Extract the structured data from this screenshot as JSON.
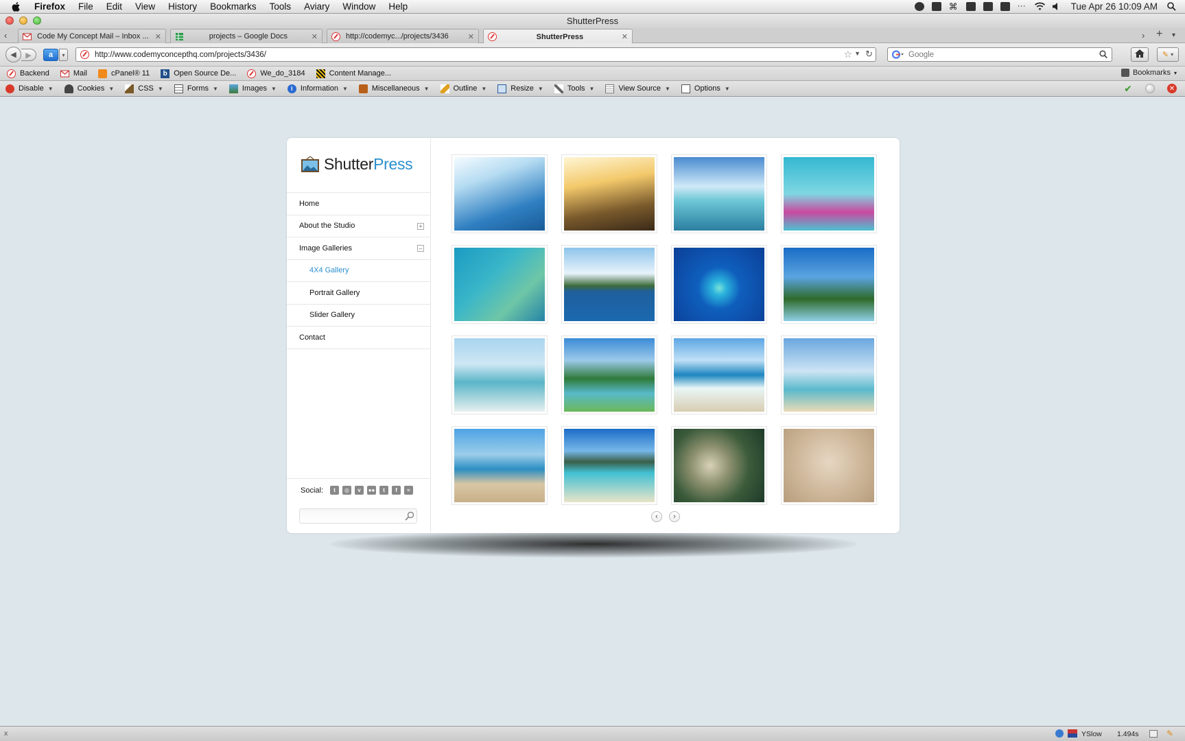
{
  "menubar": {
    "app_name": "Firefox",
    "items": [
      "File",
      "Edit",
      "View",
      "History",
      "Bookmarks",
      "Tools",
      "Aviary",
      "Window",
      "Help"
    ],
    "clock": "Tue Apr 26  10:09 AM"
  },
  "window": {
    "title": "ShutterPress"
  },
  "tabs": [
    {
      "label": "Code My Concept Mail – Inbox ..."
    },
    {
      "label": "projects – Google Docs"
    },
    {
      "label": "http://codemyc.../projects/3436"
    },
    {
      "label": "ShutterPress"
    }
  ],
  "navbar": {
    "url": "http://www.codemyconcepthq.com/projects/3436/",
    "search_placeholder": "Google"
  },
  "bookmarks": {
    "items": [
      "Backend",
      "Mail",
      "cPanel® 11",
      "Open Source De...",
      "We_do_3184",
      "Content Manage..."
    ],
    "right_label": "Bookmarks"
  },
  "devtoolbar": {
    "items": [
      "Disable",
      "Cookies",
      "CSS",
      "Forms",
      "Images",
      "Information",
      "Miscellaneous",
      "Outline",
      "Resize",
      "Tools",
      "View Source",
      "Options"
    ]
  },
  "site": {
    "logo": {
      "part1": "Shutter",
      "part2": "Press"
    },
    "nav": [
      {
        "label": "Home",
        "toggle": ""
      },
      {
        "label": "About the Studio",
        "toggle": "+"
      },
      {
        "label": "Image Galleries",
        "toggle": "–"
      },
      {
        "label": "4X4 Gallery",
        "toggle": ""
      },
      {
        "label": "Portrait Gallery",
        "toggle": ""
      },
      {
        "label": "Slider Gallery",
        "toggle": ""
      },
      {
        "label": "Contact",
        "toggle": ""
      }
    ],
    "social_label": "Social:",
    "social_icons": [
      "t",
      "◎",
      "v",
      "●●",
      "t",
      "f",
      "≈"
    ],
    "search_placeholder": "",
    "gallery": [
      {
        "name": "palm-sun-photo",
        "bg": "linear-gradient(160deg,#f4fbff 0%,#b6dcf2 30%,#2f7fc1 70%,#1a5b97 100%)"
      },
      {
        "name": "palm-hut-photo",
        "bg": "linear-gradient(170deg,#fff6d5 0%,#f3c96b 35%,#7a5a2c 70%,#3a2a18 100%)"
      },
      {
        "name": "pier-photo",
        "bg": "linear-gradient(180deg,#4a8bd0 0%,#cfe9f7 40%,#6ac6d6 60%,#2a7ea0 100%)"
      },
      {
        "name": "flippers-photo",
        "bg": "linear-gradient(180deg,#34b8d2 0%,#7fd7e2 50%,#c94aa0 75%,#4cc1d0 100%)"
      },
      {
        "name": "snorkeler-photo",
        "bg": "linear-gradient(135deg,#1b9bc2 0%,#3ab6c9 40%,#6ec6a6 70%,#2483a6 100%)"
      },
      {
        "name": "island-photo",
        "bg": "linear-gradient(180deg,#8ec4ea 0%,#e8f3fb 35%,#3c6b3a 52%,#1f5f9c 60%,#1b69b0 100%)"
      },
      {
        "name": "atoll-photo",
        "bg": "radial-gradient(circle at 50% 55%,#7be2d8 0%,#2ab2dd 12%,#0f5fbd 35%,#0b3f97 100%)"
      },
      {
        "name": "palms-sky-photo",
        "bg": "linear-gradient(180deg,#1a6cc6 0%,#5aa4e0 40%,#2f6a2b 70%,#8fd0e6 100%)"
      },
      {
        "name": "catamaran-photo",
        "bg": "linear-gradient(180deg,#a8d4ef 0%,#cfe7f4 35%,#5bb5c8 60%,#e6f0ef 100%)"
      },
      {
        "name": "lagoon-palms-photo",
        "bg": "linear-gradient(180deg,#3a8bd6 0%,#9cc9ea 30%,#2f7a3a 55%,#58b9c9 75%,#6bb85a 100%)"
      },
      {
        "name": "wave-photo",
        "bg": "linear-gradient(180deg,#5da6e4 0%,#bfe0f6 30%,#1d86c0 50%,#e9f6f6 68%,#d8cdb2 100%)"
      },
      {
        "name": "leaning-palm-photo",
        "bg": "linear-gradient(180deg,#6aa7df 0%,#cde4f4 45%,#5ab9cc 70%,#eadbb6 100%)"
      },
      {
        "name": "beach-boats-photo",
        "bg": "linear-gradient(180deg,#4da3e4 0%,#9ccdea 35%,#2c8ec2 55%,#d8c6a4 75%,#c8b08a 100%)"
      },
      {
        "name": "shallow-beach-photo",
        "bg": "linear-gradient(180deg,#1c6cc8 0%,#77b7e8 30%,#3a5f48 45%,#41c0d3 60%,#e9e4c8 100%)"
      },
      {
        "name": "coral-photo",
        "bg": "radial-gradient(circle at 40% 50%,#d8d2b8 0%,#8b8f6e 30%,#3b5b3a 60%,#1e3a2a 100%)"
      },
      {
        "name": "sand-heart-photo",
        "bg": "radial-gradient(circle at 50% 45%,#e6d7c2 0%,#cdb699 55%,#b79d7c 100%)"
      }
    ]
  },
  "statusbar": {
    "close": "x",
    "yslow": "YSlow",
    "time": "1.494s"
  }
}
